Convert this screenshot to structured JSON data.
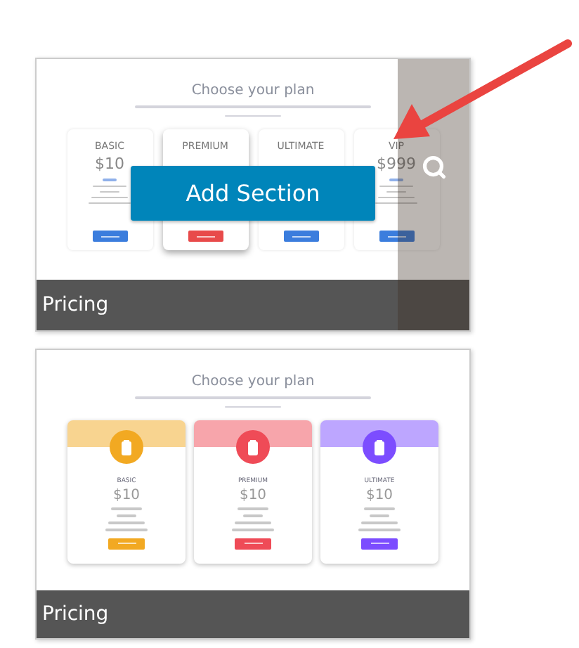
{
  "templates": [
    {
      "hovered": true,
      "caption": "Pricing",
      "add_button": "Add Section",
      "preview": {
        "kind": "plain",
        "title": "Choose your plan",
        "plans": [
          {
            "name": "BASIC",
            "price": "$10",
            "color": "#3b7ddd",
            "raised": false
          },
          {
            "name": "PREMIUM",
            "color": "#e84a4a",
            "raised": true
          },
          {
            "name": "ULTIMATE",
            "color": "#3b7ddd",
            "raised": false
          },
          {
            "name": "VIP",
            "price": "$999",
            "color": "#3b7ddd",
            "raised": false
          }
        ]
      }
    },
    {
      "hovered": false,
      "caption": "Pricing",
      "preview": {
        "kind": "icons",
        "title": "Choose your plan",
        "plans": [
          {
            "name": "BASIC",
            "price": "$10",
            "color": "#f2a922"
          },
          {
            "name": "PREMIUM",
            "price": "$10",
            "color": "#ef4b57"
          },
          {
            "name": "ULTIMATE",
            "price": "$10",
            "color": "#7c4dff"
          }
        ]
      }
    }
  ]
}
